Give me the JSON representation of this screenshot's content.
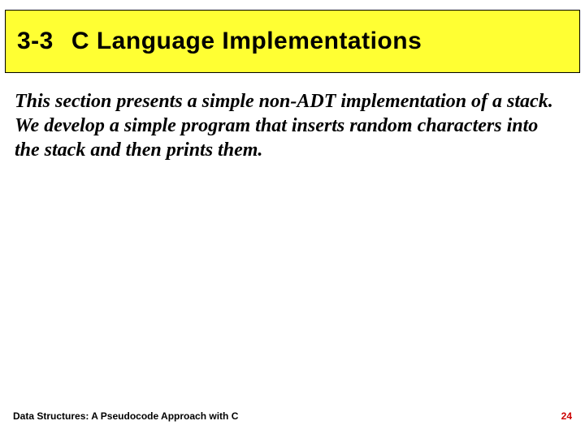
{
  "title": {
    "section_number": "3-3",
    "section_name": "C Language Implementations"
  },
  "body": {
    "paragraph": "This section presents a simple non-ADT implementation of a stack. We develop a simple program that inserts random characters into the stack and then prints them."
  },
  "footer": {
    "book_title": "Data Structures: A Pseudocode Approach with C",
    "page_number": "24"
  }
}
